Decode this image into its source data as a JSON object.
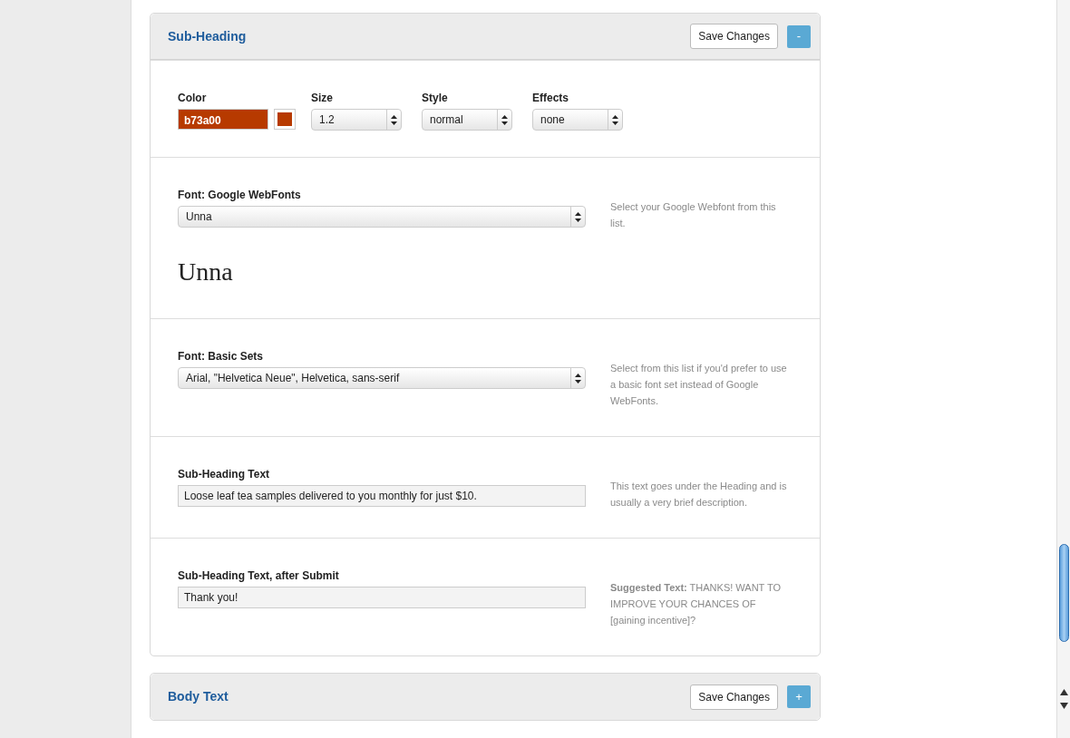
{
  "panels": [
    {
      "title": "Sub-Heading",
      "save_label": "Save Changes",
      "toggle_label": "-",
      "expanded": true,
      "style_row": [
        {
          "kind": "color",
          "label": "Color",
          "value": "b73a00",
          "color": "#b73a00"
        },
        {
          "kind": "select",
          "label": "Size",
          "value": "1.2"
        },
        {
          "kind": "select",
          "label": "Style",
          "value": "normal"
        },
        {
          "kind": "select",
          "label": "Effects",
          "value": "none"
        }
      ],
      "sections": [
        {
          "kind": "select",
          "label": "Font: Google WebFonts",
          "value": "Unna",
          "preview": "Unna",
          "hint": "Select your Google Webfont from this list."
        },
        {
          "kind": "select",
          "label": "Font: Basic Sets",
          "value": "Arial, \"Helvetica Neue\", Helvetica, sans-serif",
          "hint": "Select from this list if you'd prefer to use a basic font set instead of Google WebFonts."
        },
        {
          "kind": "text",
          "label": "Sub-Heading Text",
          "value": "Loose leaf tea samples delivered to you monthly for just $10.",
          "hint": "This text goes under the Heading and is usually a very brief description."
        },
        {
          "kind": "text",
          "label": "Sub-Heading Text, after Submit",
          "value": "Thank you!",
          "hint": "**Suggested Text:** THANKS! WANT TO IMPROVE YOUR CHANCES OF [gaining incentive]?"
        }
      ]
    },
    {
      "title": "Body Text",
      "save_label": "Save Changes",
      "toggle_label": "+",
      "expanded": false
    }
  ]
}
